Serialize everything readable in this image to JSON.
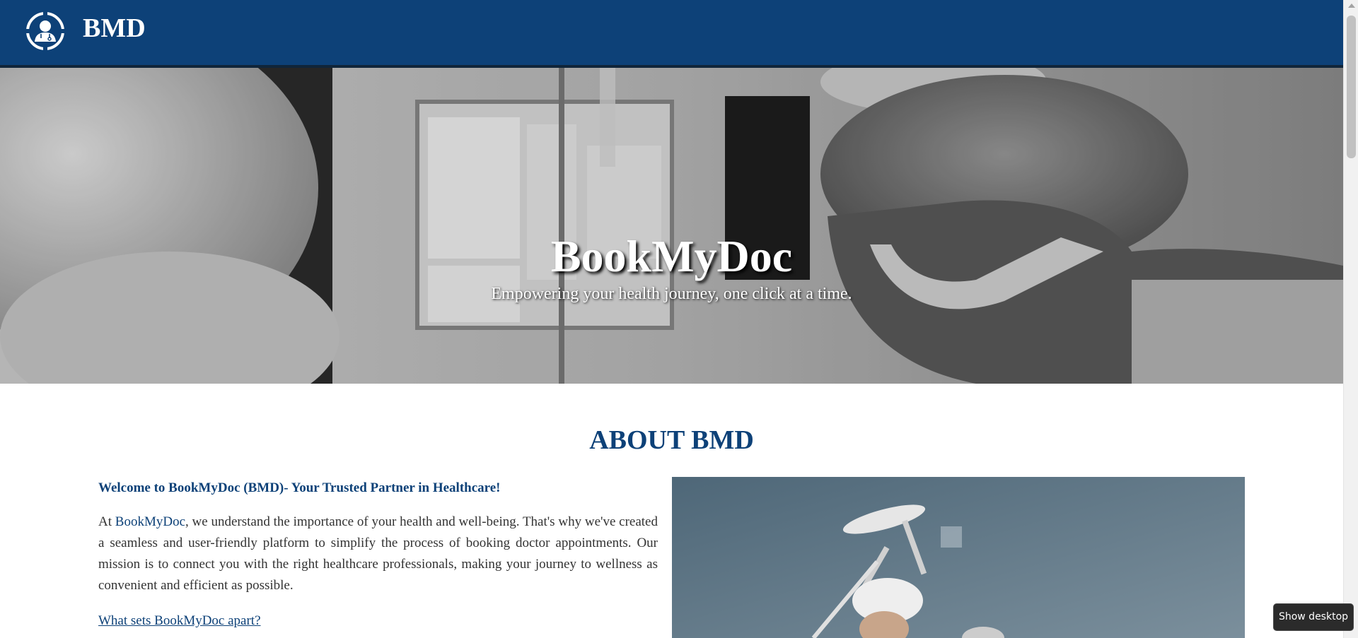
{
  "header": {
    "brand": "BMD",
    "logo_icon": "doctor-icon",
    "background": "#0d4178"
  },
  "hero": {
    "title": "BookMyDoc",
    "subtitle": "Empowering your health journey, one click at a time."
  },
  "about": {
    "heading": "ABOUT BMD",
    "welcome": "Welcome to BookMyDoc (BMD)- Your Trusted Partner in Healthcare!",
    "para_prefix": "At ",
    "para_brand": "BookMyDoc",
    "para_rest": ", we understand the importance of your health and well-being. That's why we've created a seamless and user-friendly platform to simplify the process of booking doctor appointments. Our mission is to connect you with the right healthcare professionals, making your journey to wellness as convenient and efficient as possible.",
    "link": "What sets BookMyDoc apart?"
  },
  "tooltip": {
    "label": "Show desktop"
  },
  "colors": {
    "accent": "#0d4178",
    "text": "#333333"
  }
}
